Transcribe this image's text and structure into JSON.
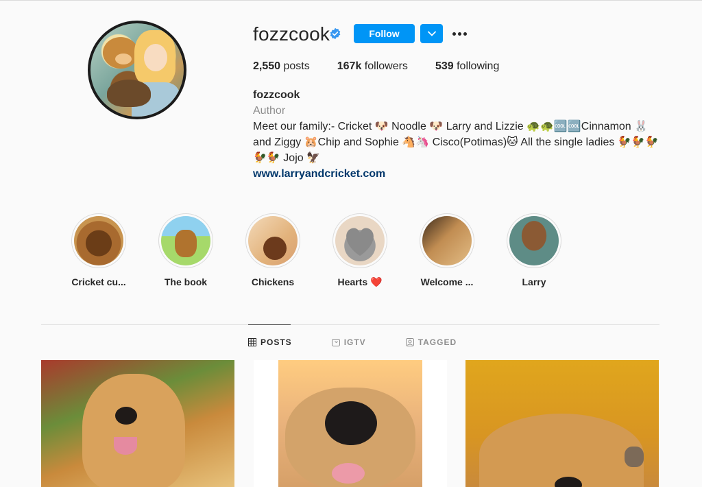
{
  "profile": {
    "username": "fozzcook",
    "follow_label": "Follow",
    "stats": [
      {
        "value": "2,550",
        "label": "posts"
      },
      {
        "value": "167k",
        "label": "followers"
      },
      {
        "value": "539",
        "label": "following"
      }
    ],
    "bio": {
      "name": "fozzcook",
      "category": "Author",
      "text": "Meet our family:- Cricket 🐶 Noodle 🐶 Larry and Lizzie 🐢🐢🆒🆒Cinnamon 🐰 and Ziggy 🐹Chip and Sophie 🐴🦄 Cisco(Potimas)🐱 All the single ladies 🐓🐓🐓🐓🐓 Jojo 🦅",
      "link": "www.larryandcricket.com"
    }
  },
  "highlights": [
    {
      "label": "Cricket cu..."
    },
    {
      "label": "The book"
    },
    {
      "label": "Chickens"
    },
    {
      "label": "Hearts ❤️"
    },
    {
      "label": "Welcome ..."
    },
    {
      "label": "Larry"
    }
  ],
  "tabs": [
    {
      "label": "POSTS",
      "icon": "grid-icon"
    },
    {
      "label": "IGTV",
      "icon": "igtv-icon"
    },
    {
      "label": "TAGGED",
      "icon": "tagged-icon"
    }
  ],
  "colors": {
    "accent": "#0095f6",
    "background": "#fafafa",
    "text": "#262626",
    "muted": "#8e8e8e",
    "link": "#00376b"
  }
}
